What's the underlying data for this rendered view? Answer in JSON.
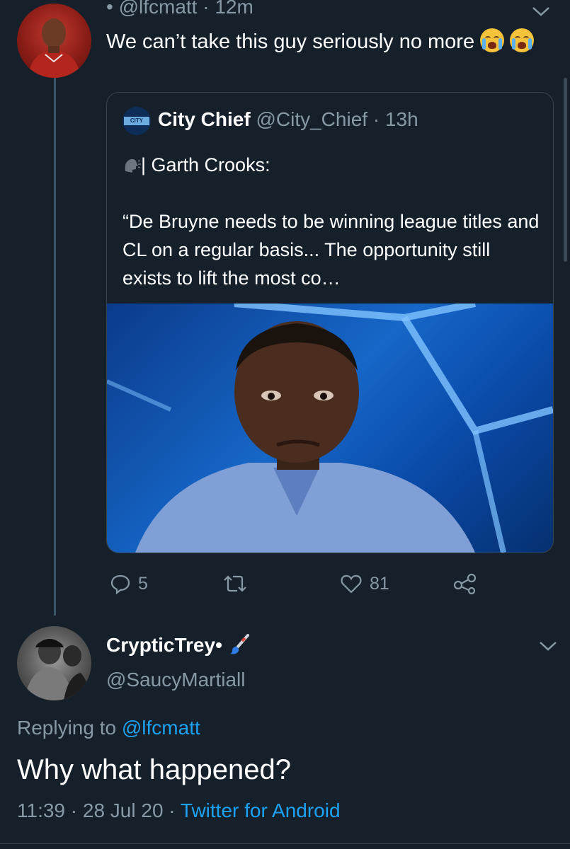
{
  "tweet": {
    "handle_meta": "• @lfcmatt · 12m",
    "text": "We can’t take this guy seriously no more",
    "emoji_icon": "loudly-crying-face"
  },
  "quote": {
    "name": "City Chief",
    "handle_time": "@City_Chief · 13h",
    "avatar_text": "CITY CHIEF",
    "line1": "| Garth Crooks:",
    "line2": "“De Bruyne needs to be winning league titles and CL on a regular basis... The opportunity still exists to lift the most co…",
    "speaker_icon": "speaking-head"
  },
  "actions": {
    "replies": "5",
    "retweets": "",
    "likes": "81"
  },
  "reply": {
    "name": "CrypticTrey•",
    "name_icon": "paintbrush",
    "handle": "@SaucyMartiall",
    "replying_prefix": "Replying to ",
    "replying_handle": "@lfcmatt",
    "text": "Why what happened?",
    "time_date": "11:39 · 28 Jul 20 · ",
    "source": "Twitter for Android"
  },
  "colors": {
    "background": "#15202b",
    "muted": "#8899a6",
    "link": "#1da1f2",
    "border": "#38444d"
  }
}
